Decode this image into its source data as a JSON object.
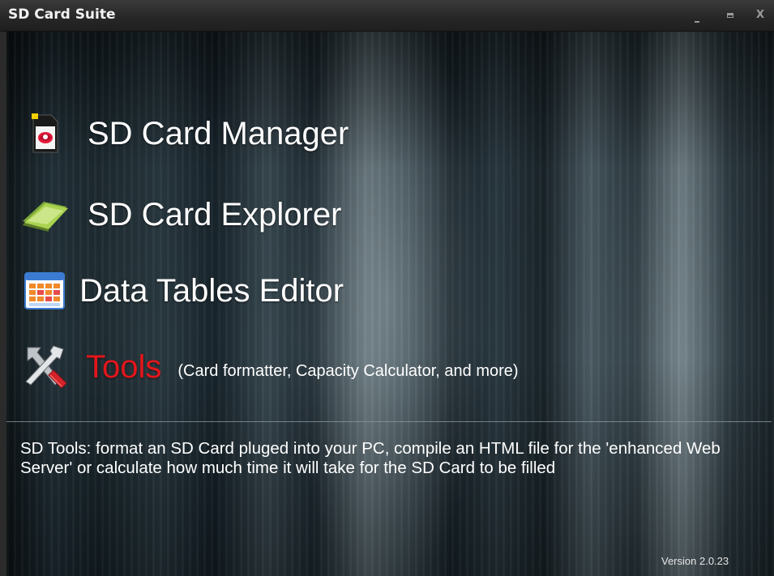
{
  "window": {
    "title": "SD Card Suite",
    "controls": {
      "minimize": "minimize-icon",
      "maximize": "maximize-icon",
      "close": "X"
    }
  },
  "menu": {
    "items": [
      {
        "label": "SD Card Manager",
        "icon": "sd-card-icon"
      },
      {
        "label": "SD Card Explorer",
        "icon": "folder-icon"
      },
      {
        "label": "Data Tables Editor",
        "icon": "table-icon"
      },
      {
        "label": "Tools",
        "icon": "tools-icon",
        "sublabel": "(Card formatter, Capacity Calculator,  and more)",
        "accent": "#e3161b"
      }
    ]
  },
  "description": "SD Tools: format an SD Card pluged into your PC, compile an HTML file for the 'enhanced Web Server' or calculate how much time it will take for the SD Card to be filled",
  "version": "Version 2.0.23"
}
